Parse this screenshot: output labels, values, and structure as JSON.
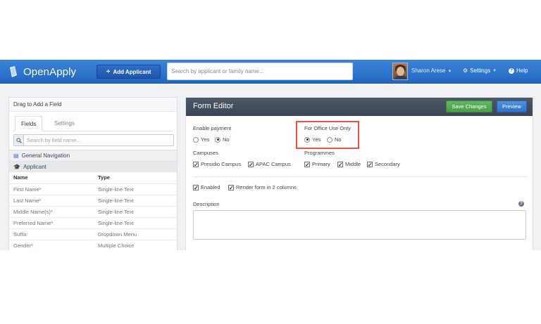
{
  "topbar": {
    "app_name": "OpenApply",
    "add_button_label": "Add Applicant",
    "search_placeholder": "Search by applicant or family name...",
    "user_name": "Sharon Arese",
    "settings_label": "Settings",
    "help_label": "Help",
    "bar_color": "#2a74cf"
  },
  "left_panel": {
    "title": "Drag to Add a Field",
    "tabs": [
      "Fields",
      "Settings"
    ],
    "active_tab": "Fields",
    "search_placeholder": "Search by field name...",
    "groups": [
      "General Navigation",
      "Applicant"
    ],
    "columns": [
      "Name",
      "Type"
    ],
    "rows": [
      {
        "name": "First Name",
        "required": true,
        "type": "Single-line Text"
      },
      {
        "name": "Last Name",
        "required": true,
        "type": "Single-line Text"
      },
      {
        "name": "Middle Name(s)",
        "required": true,
        "type": "Single-line Text"
      },
      {
        "name": "Preferred Name",
        "required": true,
        "type": "Single-line Text"
      },
      {
        "name": "Suffix",
        "required": false,
        "type": "Dropdown Menu"
      },
      {
        "name": "Gender",
        "required": true,
        "type": "Multiple Choice"
      }
    ]
  },
  "form_editor": {
    "title": "Form Editor",
    "save_label": "Save Changes",
    "preview_label": "Preview",
    "enable_payment": {
      "label": "Enable payment",
      "options": [
        "Yes",
        "No"
      ],
      "selected": "No"
    },
    "office_use": {
      "label": "For Office Use Only",
      "options": [
        "Yes",
        "No"
      ],
      "selected": "Yes"
    },
    "campuses": {
      "label": "Campuses",
      "options": [
        "Presidio Campus",
        "APAC Campus"
      ]
    },
    "programmes": {
      "label": "Programmes",
      "options": [
        "Primary",
        "Middle",
        "Secondary"
      ]
    },
    "enabled_label": "Enabled",
    "two_columns_label": "Render form in 2 columns",
    "description_label": "Description",
    "highlight_color": "#e0553e"
  }
}
